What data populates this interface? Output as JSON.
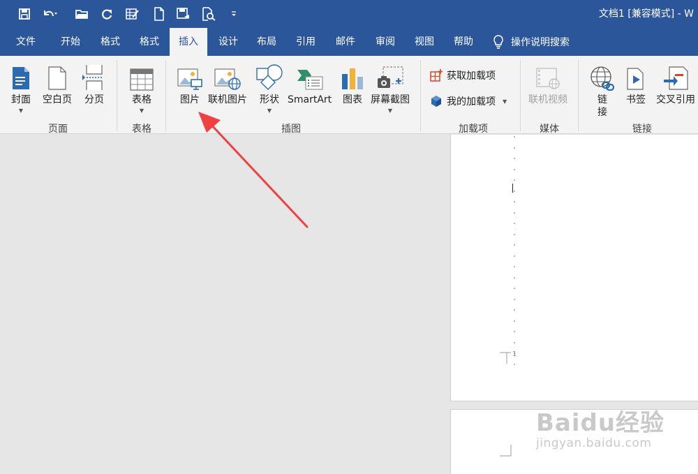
{
  "titlebar": {
    "doc_title": "文档1 [兼容模式] - W"
  },
  "quick_access": [
    "save-icon",
    "undo-icon",
    "open-folder-icon",
    "redo-icon",
    "table-draw-icon",
    "new-doc-icon",
    "save-as-icon",
    "print-preview-icon",
    "customize-icon"
  ],
  "tabs": [
    "文件",
    "开始",
    "格式",
    "格式",
    "插入",
    "设计",
    "布局",
    "引用",
    "邮件",
    "审阅",
    "视图",
    "帮助"
  ],
  "active_tab": "插入",
  "tellme": "操作说明搜索",
  "ribbon": {
    "pages": {
      "cover": "封面",
      "blank": "空白页",
      "break": "分页",
      "group": "页面"
    },
    "tables": {
      "table": "表格",
      "group": "表格"
    },
    "illustrations": {
      "picture": "图片",
      "online_picture": "联机图片",
      "shapes": "形状",
      "smartart": "SmartArt",
      "chart": "图表",
      "screenshot": "屏幕截图",
      "group": "插图"
    },
    "addins": {
      "get": "获取加载项",
      "mine": "我的加载项",
      "group": "加载项"
    },
    "media": {
      "online_video": "联机视频",
      "group": "媒体"
    },
    "links": {
      "link_line1": "链",
      "link_line2": "接",
      "bookmark": "书签",
      "crossref": "交叉引用",
      "group": "链接"
    }
  },
  "page": {
    "number": "1"
  },
  "watermark": {
    "brand": "Baidu经验",
    "url": "jingyan.baidu.com"
  },
  "colors": {
    "accent": "#2b579a",
    "arrow": "#f04040"
  }
}
